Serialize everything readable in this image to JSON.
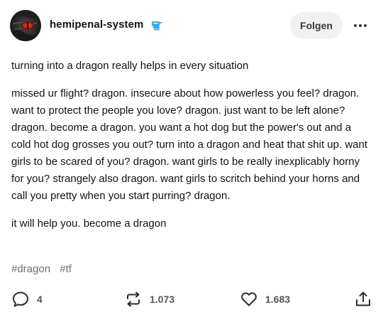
{
  "header": {
    "username": "hemipenal-system",
    "follow_label": "Folgen"
  },
  "post": {
    "paragraphs": [
      "turning into a dragon really helps in every situation",
      "missed ur flight? dragon. insecure about how powerless you feel? dragon. want to protect the people you love? dragon. just want to be left alone? dragon. become a dragon. you want a hot dog but the power's out and a cold hot dog grosses you out? turn into a dragon and heat that shit up. want girls to be scared of you? dragon. want girls to be really inexplicably horny for you? strangely also dragon. want girls to scritch behind your horns and call you pretty when you start purring? dragon.",
      "it will help you. become a dragon"
    ],
    "tags": [
      "#dragon",
      "#tf"
    ]
  },
  "footer": {
    "replies": "4",
    "reblogs": "1.073",
    "likes": "1.683"
  },
  "icons": {
    "badge": "badge-icon",
    "more": "more-dots-icon",
    "reply": "speech-bubble-icon",
    "reblog": "reblog-icon",
    "like": "heart-icon",
    "share": "share-icon"
  },
  "colors": {
    "badge_blue": "#3fa7e6",
    "text": "#121212",
    "muted": "#6e6e6e",
    "button_bg": "#f1f1f1"
  }
}
